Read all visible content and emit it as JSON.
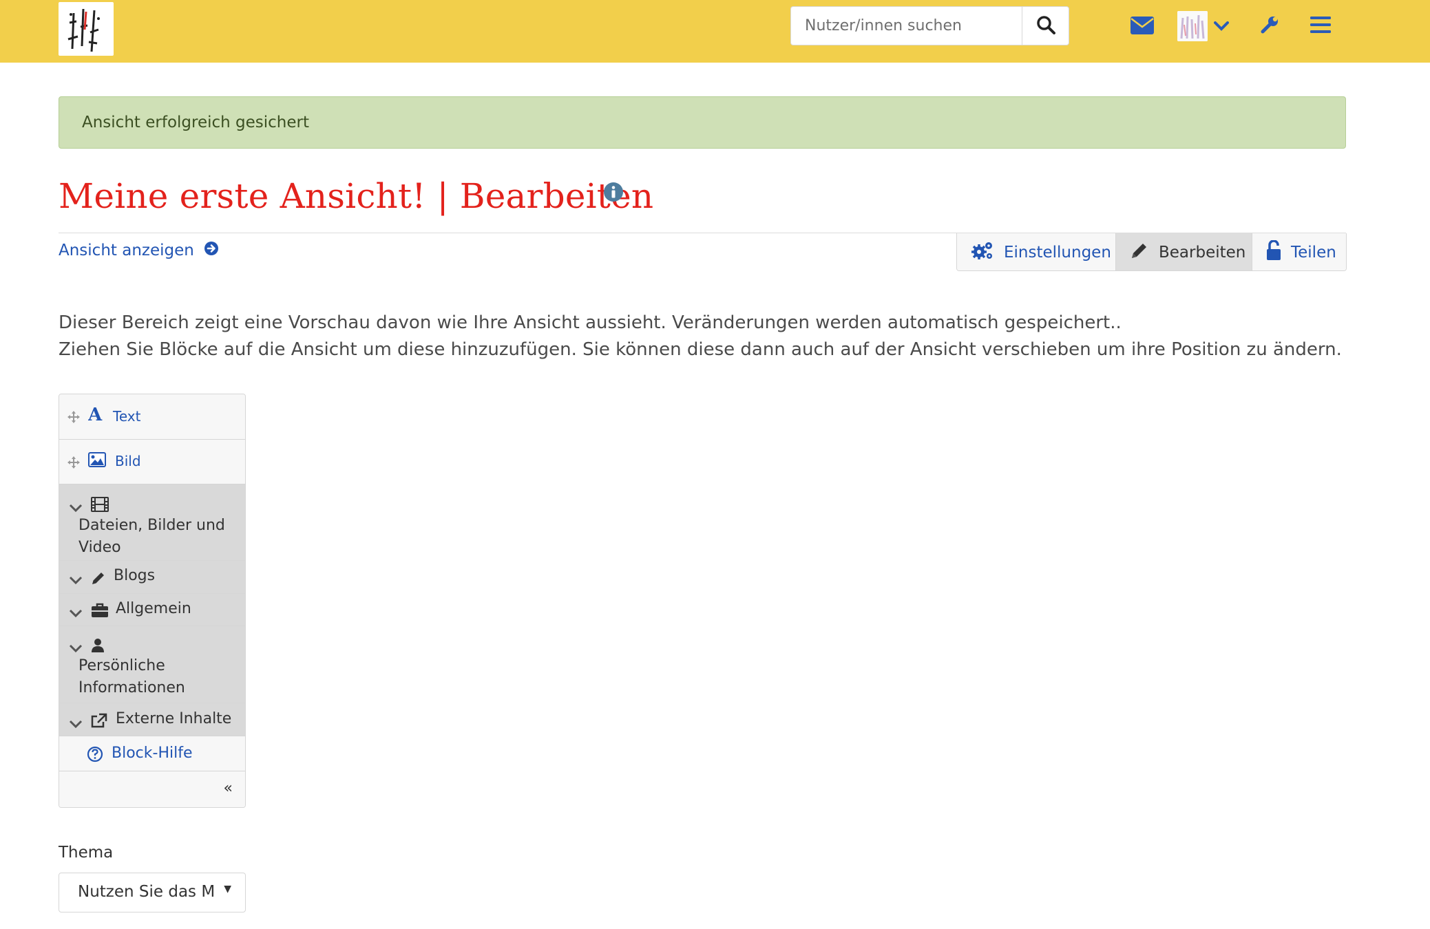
{
  "header": {
    "search_placeholder": "Nutzer/innen suchen"
  },
  "alert": {
    "message": "Ansicht erfolgreich gesichert"
  },
  "page": {
    "title": "Meine erste Ansicht! | Bearbeiten",
    "view_link": "Ansicht anzeigen"
  },
  "tabs": [
    {
      "label": "Einstellungen",
      "icon": "gears-icon"
    },
    {
      "label": "Bearbeiten",
      "icon": "pencil-icon"
    },
    {
      "label": "Teilen",
      "icon": "unlock-icon"
    }
  ],
  "description": {
    "line1": "Dieser Bereich zeigt eine Vorschau davon wie Ihre Ansicht aussieht. Veränderungen werden automatisch gespeichert..",
    "line2": "Ziehen Sie Blöcke auf die Ansicht um diese hinzuzufügen. Sie können diese dann auch auf der Ansicht verschieben um ihre Position zu ändern."
  },
  "blocks": {
    "text": "Text",
    "image": "Bild",
    "categories": [
      {
        "line1": "Dateien, Bilder und",
        "line2": "Video"
      },
      {
        "line1": "Blogs"
      },
      {
        "line1": "Allgemein"
      },
      {
        "line1": "Persönliche",
        "line2": "Informationen"
      },
      {
        "line1": "Externe Inhalte"
      }
    ],
    "help": "Block-Hilfe",
    "collapse": "«"
  },
  "theme": {
    "label": "Thema",
    "selected": "Nutzen Sie das Mo"
  },
  "colors": {
    "header_bg": "#f2cf4b",
    "title": "#e3221c",
    "link": "#2255b3",
    "alert_bg": "#cfe0b6"
  }
}
